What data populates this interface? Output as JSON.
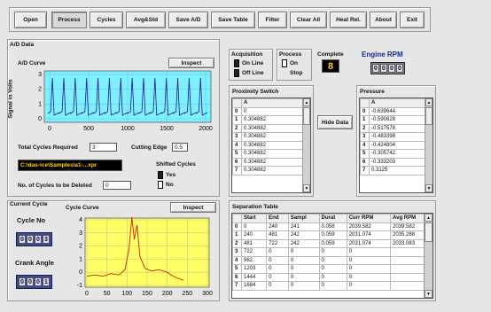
{
  "toolbar": {
    "open": "Open",
    "process": "Process",
    "cycles": "Cycles",
    "avg_std": "Avg&Std",
    "save_ad": "Save A/D",
    "save_table": "Save Table",
    "filter": "Filter",
    "clear_all": "Clear All",
    "heat_rel": "Heat Rel.",
    "about": "About",
    "exit": "Exit"
  },
  "ad": {
    "section": "A/D Data",
    "curve_title": "A/D Curve",
    "inspect": "Inspect",
    "ylabel": "Signal in Volts",
    "yticks": [
      "3",
      "2",
      "1",
      "0"
    ],
    "xticks": [
      "0",
      "500",
      "1000",
      "1500",
      "2000"
    ],
    "total_cycles_label": "Total Cycles Required",
    "total_cycles_value": "3",
    "cutting_edge_label": "Cutting Edge",
    "cutting_edge_value": "0.5",
    "file_path": "C:\\das-ice\\Samples\\a1-...xpr",
    "shifted_label": "Shifted Cycles",
    "yes": "Yes",
    "no": "No",
    "deleted_label": "No. of Cycles to be Deleted",
    "deleted_value": "0"
  },
  "cycle": {
    "section": "Current Cycle",
    "cycle_no_label": "Cycle No",
    "cycle_no_digits": [
      "0",
      "0",
      "0",
      "3"
    ],
    "crank_label": "Crank Angle",
    "crank_digits": [
      "0",
      "0",
      "0",
      "1"
    ],
    "curve_title": "Cycle Curve",
    "inspect": "Inspect",
    "yticks": [
      "4",
      "3",
      "2",
      "1",
      "0",
      "-1"
    ],
    "xticks": [
      "0",
      "50",
      "100",
      "150",
      "200",
      "250",
      "300"
    ]
  },
  "status": {
    "acq_label": "Acquisition",
    "on_line": "On Line",
    "off_line": "Off Line",
    "process_label": "Process",
    "on": "On",
    "stop": "Stop",
    "complete_label": "Complete",
    "complete_value": "8",
    "rpm_label": "Engine RPM",
    "rpm_digits": [
      "0",
      "0",
      "0",
      "0"
    ]
  },
  "proximity": {
    "title": "Proximity Switch",
    "col": "A",
    "rows": [
      "0",
      "0.304882",
      "0.304882",
      "0.304882",
      "0.304882",
      "0.304882",
      "0.304882",
      "0.304882"
    ],
    "indices": [
      "0",
      "1",
      "2",
      "3",
      "4",
      "5",
      "6",
      "7"
    ]
  },
  "hide_data": "Hide Data",
  "pressure": {
    "title": "Pressure",
    "col": "A",
    "rows": [
      "-0.639644",
      "-0.590828",
      "-0.517578",
      "-0.483398",
      "-0.424804",
      "-0.305742",
      "-0.333203",
      "0.3125"
    ],
    "indices": [
      "0",
      "1",
      "2",
      "3",
      "4",
      "5",
      "6",
      "7"
    ]
  },
  "separation": {
    "title": "Separation Table",
    "headers": [
      "",
      "Start",
      "End",
      "Sampl",
      "Durat",
      "Curr RPM",
      "Avg RPM"
    ],
    "rows": [
      [
        "0",
        "0",
        "240",
        "241",
        "0.058",
        "2039.582",
        "2039.582"
      ],
      [
        "1",
        "240",
        "481",
        "242",
        "0.059",
        "2031.074",
        "2035.288"
      ],
      [
        "2",
        "481",
        "722",
        "242",
        "0.059",
        "2031.074",
        "2033.083"
      ],
      [
        "3",
        "722",
        "0",
        "0",
        "0",
        "0",
        ""
      ],
      [
        "4",
        "962",
        "0",
        "0",
        "0",
        "0",
        ""
      ],
      [
        "5",
        "1203",
        "0",
        "0",
        "0",
        "0",
        ""
      ],
      [
        "6",
        "1444",
        "0",
        "0",
        "0",
        "0",
        ""
      ],
      [
        "7",
        "1684",
        "0",
        "0",
        "0",
        "0",
        ""
      ]
    ]
  },
  "colors": {
    "plot_bg": "#7ff0ff",
    "plot_line": "#1a1a8a",
    "cycle_bg": "#ffff66",
    "cycle_line": "#cc2200",
    "digits_bg": "#3547a8"
  }
}
